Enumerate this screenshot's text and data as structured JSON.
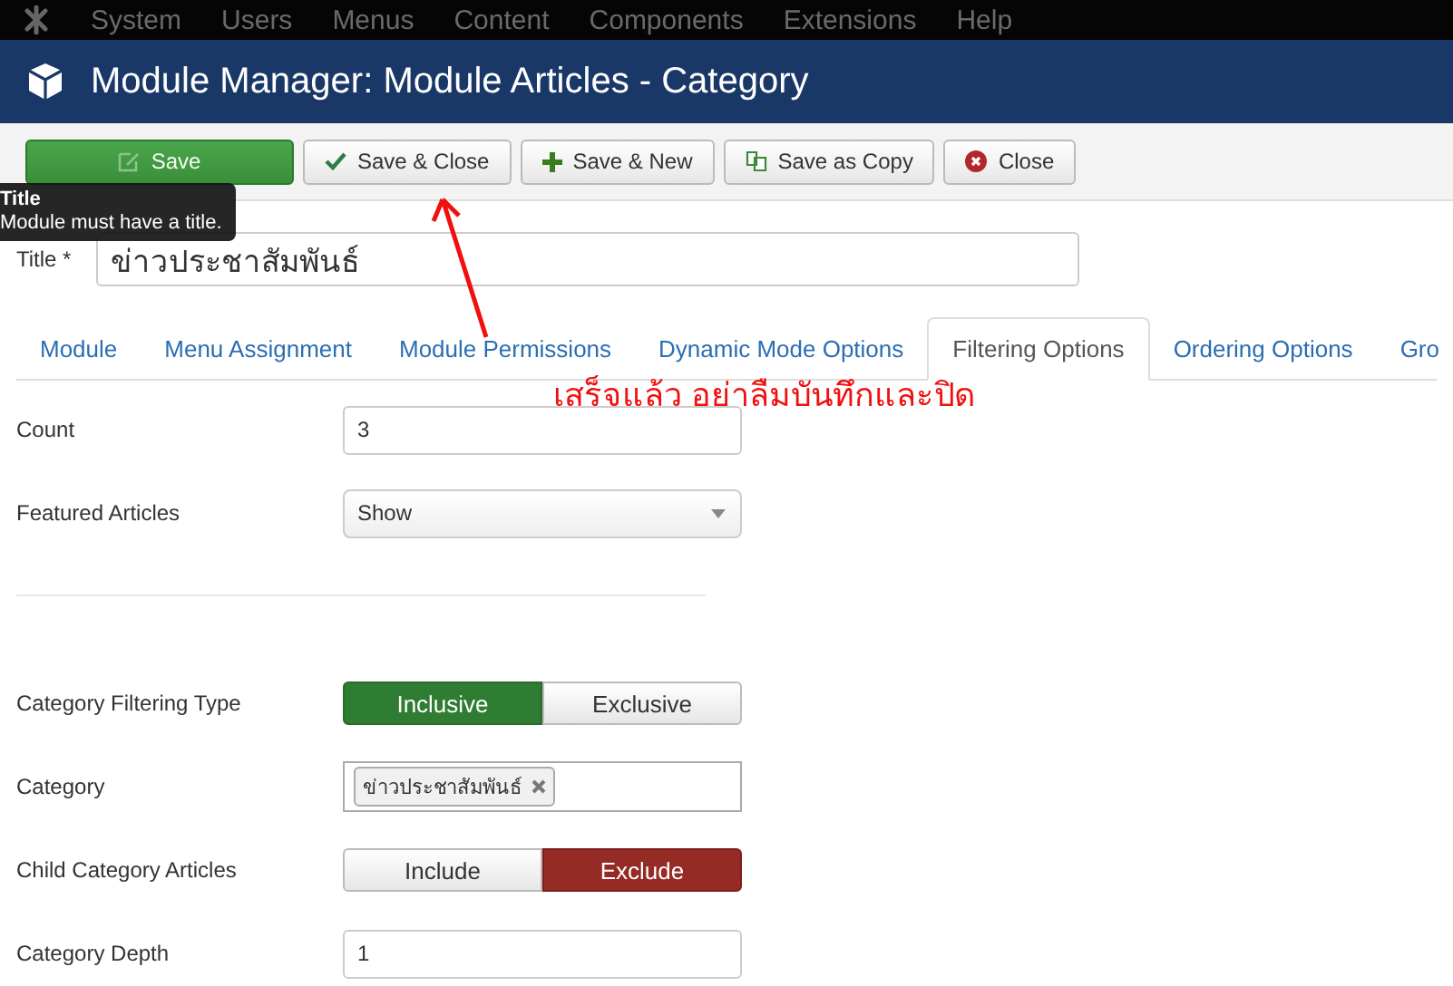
{
  "menu_bar": {
    "items": [
      "System",
      "Users",
      "Menus",
      "Content",
      "Components",
      "Extensions",
      "Help"
    ]
  },
  "header": {
    "title": "Module Manager: Module Articles - Category"
  },
  "toolbar": {
    "buttons": [
      {
        "kind": "save",
        "label": "Save"
      },
      {
        "kind": "check",
        "label": "Save & Close"
      },
      {
        "kind": "plus",
        "label": "Save & New"
      },
      {
        "kind": "copy",
        "label": "Save as Copy"
      },
      {
        "kind": "close",
        "label": "Close"
      }
    ]
  },
  "tooltip": {
    "title": "Title",
    "text": "Module must have a title."
  },
  "title_field": {
    "label": "Title *",
    "value": "ข่าวประชาสัมพันธ์"
  },
  "tabs": [
    {
      "label": "Module",
      "selected": false
    },
    {
      "label": "Menu Assignment",
      "selected": false
    },
    {
      "label": "Module Permissions",
      "selected": false
    },
    {
      "label": "Dynamic Mode Options",
      "selected": false
    },
    {
      "label": "Filtering Options",
      "selected": true
    },
    {
      "label": "Ordering Options",
      "selected": false
    },
    {
      "label": "Gro",
      "selected": false
    }
  ],
  "annotation": {
    "text": "เสร็จแล้ว อย่าลืมบันทึกและปิด"
  },
  "fields": [
    {
      "kind": "text",
      "label": "Count",
      "value": "3"
    },
    {
      "kind": "select",
      "label": "Featured Articles",
      "value": "Show"
    },
    {
      "kind": "divider"
    },
    {
      "kind": "toggle",
      "label": "Category Filtering Type",
      "options": [
        {
          "label": "Inclusive",
          "selected": true
        },
        {
          "label": "Exclusive",
          "selected": false
        }
      ]
    },
    {
      "kind": "tags",
      "label": "Category",
      "tags": [
        "ข่าวประชาสัมพันธ์"
      ]
    },
    {
      "kind": "toggle",
      "label": "Child Category Articles",
      "options": [
        {
          "label": "Include",
          "selected": false
        },
        {
          "label": "Exclude",
          "selected": true
        }
      ]
    },
    {
      "kind": "text",
      "label": "Category Depth",
      "value": "1"
    }
  ]
}
